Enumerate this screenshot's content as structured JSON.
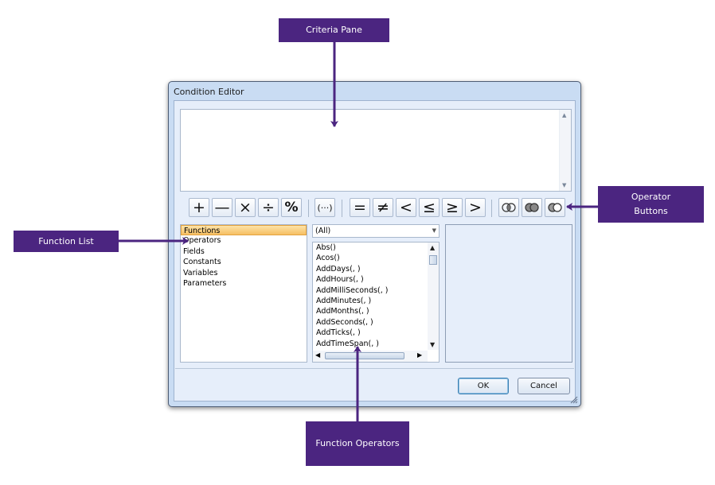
{
  "callouts": {
    "criteria_pane": "Criteria Pane",
    "operator_buttons": "Operator Buttons",
    "function_list": "Function List",
    "function_operators": "Function Operators"
  },
  "dialog": {
    "title": "Condition Editor",
    "operator_buttons": [
      {
        "name": "plus-button",
        "glyph": "+"
      },
      {
        "name": "minus-button",
        "glyph": "—"
      },
      {
        "name": "multiply-button",
        "glyph": "×"
      },
      {
        "name": "divide-button",
        "glyph": "÷"
      },
      {
        "name": "modulo-button",
        "glyph": "%"
      },
      {
        "name": "parentheses-button",
        "glyph": "(···)"
      },
      {
        "name": "equal-button",
        "glyph": "="
      },
      {
        "name": "not-equal-button",
        "glyph": "≠"
      },
      {
        "name": "less-than-button",
        "glyph": "<"
      },
      {
        "name": "less-or-equal-button",
        "glyph": "≤"
      },
      {
        "name": "greater-or-equal-button",
        "glyph": "≥"
      },
      {
        "name": "greater-than-button",
        "glyph": ">"
      },
      {
        "name": "and-button",
        "icon": "venn-and-icon"
      },
      {
        "name": "or-button",
        "icon": "venn-or-icon"
      },
      {
        "name": "not-button",
        "icon": "venn-not-icon"
      }
    ],
    "function_list": [
      "Functions",
      "Operators",
      "Fields",
      "Constants",
      "Variables",
      "Parameters"
    ],
    "function_list_selected": "Functions",
    "category_dropdown": "(All)",
    "functions": [
      "Abs()",
      "Acos()",
      "AddDays(, )",
      "AddHours(, )",
      "AddMilliSeconds(, )",
      "AddMinutes(, )",
      "AddMonths(, )",
      "AddSeconds(, )",
      "AddTicks(, )",
      "AddTimeSpan(, )"
    ],
    "ok_label": "OK",
    "cancel_label": "Cancel"
  },
  "colors": {
    "callout_bg": "#4b2580",
    "selection": "#f6bf63",
    "dialog_frame": "#c9dcf3"
  }
}
